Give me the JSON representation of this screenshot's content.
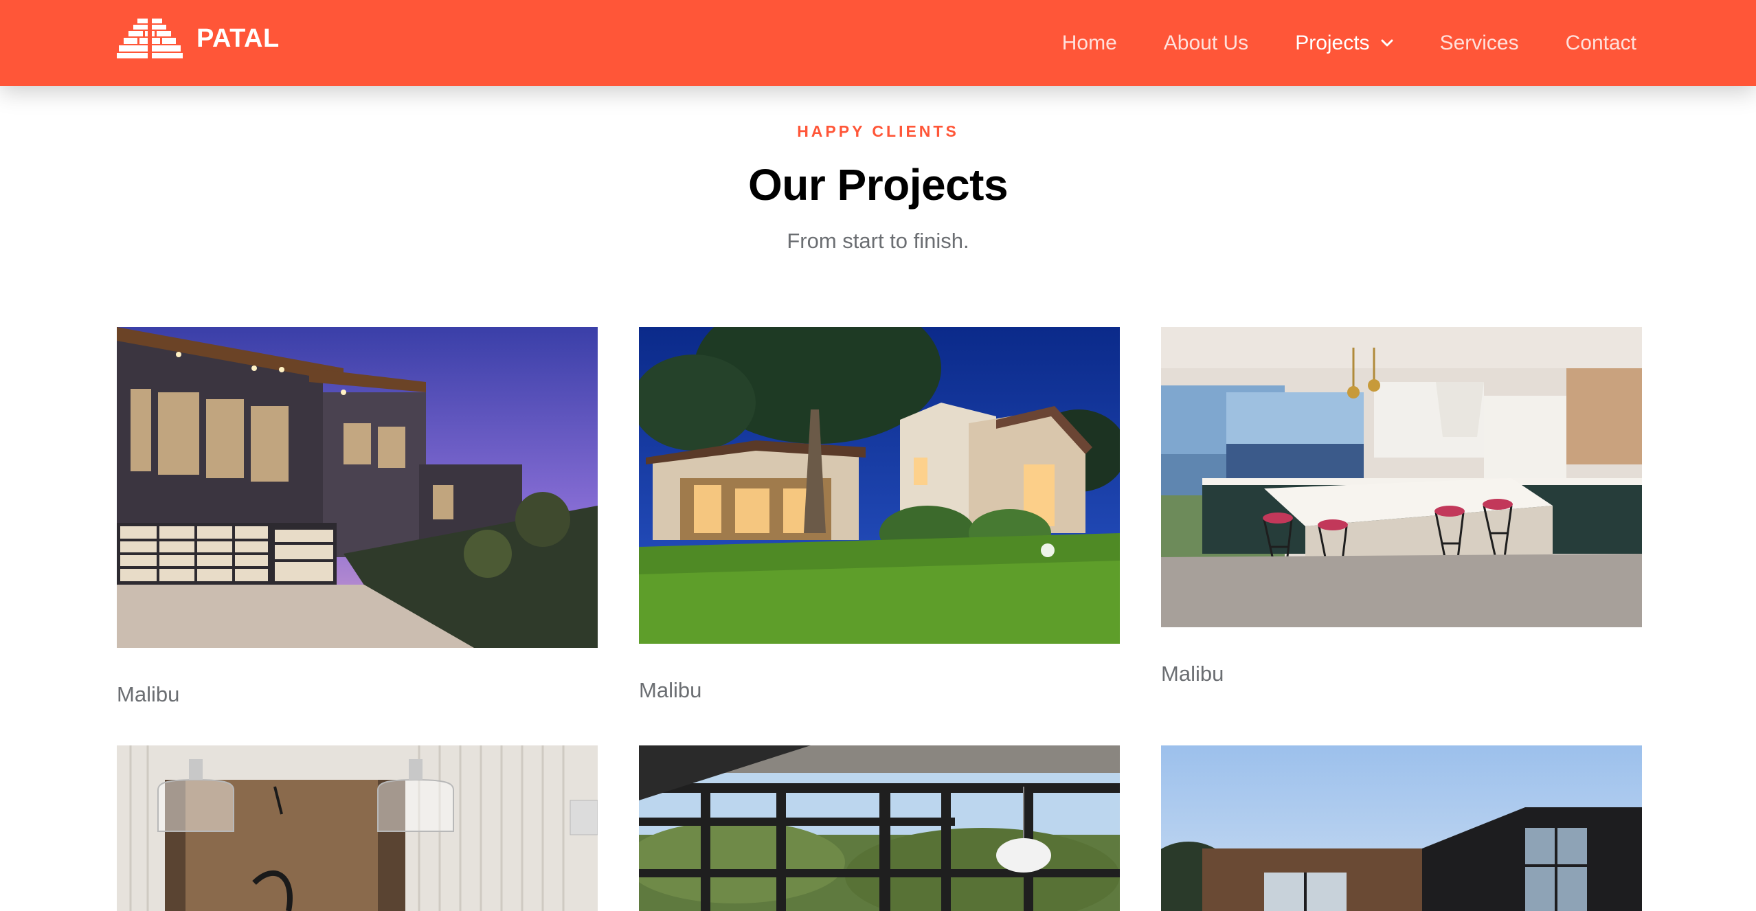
{
  "brand": {
    "name": "PATAL",
    "logo_icon": "pyramid-logo-icon"
  },
  "nav": {
    "items": [
      {
        "label": "Home"
      },
      {
        "label": "About Us"
      },
      {
        "label": "Projects",
        "dropdown_icon": "chevron-down-icon"
      },
      {
        "label": "Services"
      },
      {
        "label": "Contact"
      }
    ],
    "active": "Projects"
  },
  "section": {
    "eyebrow": "HAPPY CLIENTS",
    "title": "Our Projects",
    "subtitle": "From start to finish."
  },
  "projects": [
    {
      "caption": "Malibu",
      "image": "modern-house-dusk-photo"
    },
    {
      "caption": "Malibu",
      "image": "spanish-house-night-lawn-photo"
    },
    {
      "caption": "Malibu",
      "image": "kitchen-island-ocean-view-photo"
    },
    {
      "image": "interior-pendant-lamps-photo"
    },
    {
      "image": "interior-large-windows-photo"
    },
    {
      "image": "modern-house-blue-sky-photo"
    }
  ],
  "colors": {
    "accent": "#ff5638",
    "text_muted": "#6b6e72",
    "title": "#000000",
    "background": "#ffffff"
  }
}
